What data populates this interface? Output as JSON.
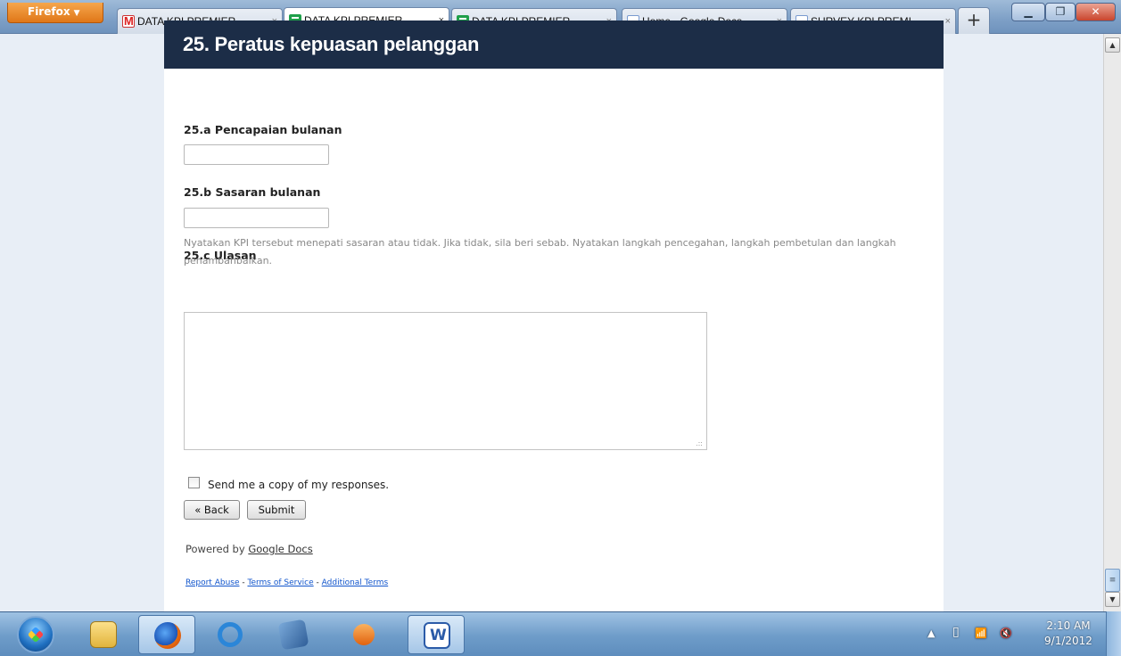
{
  "browser": {
    "menu_label": "Firefox",
    "tabs": [
      {
        "label": "DATA KPI PREMIER...",
        "icon": "gmail-icon",
        "active": false
      },
      {
        "label": "DATA KPI PREMIER...",
        "icon": "spreadsheet-icon",
        "active": true
      },
      {
        "label": "DATA KPI PREMIER...",
        "icon": "spreadsheet-icon",
        "active": false
      },
      {
        "label": "Home - Google Docs",
        "icon": "docs-icon",
        "active": false
      },
      {
        "label": "SURVEY KPI PREMI...",
        "icon": "docs-icon",
        "active": false
      }
    ],
    "close_glyph": "×",
    "new_tab_glyph": "+"
  },
  "form": {
    "section_title": "25. Peratus kepuasan pelanggan",
    "questions": [
      {
        "label": "25.a Pencapaian bulanan",
        "value": ""
      },
      {
        "label": "25.b Sasaran bulanan",
        "value": ""
      },
      {
        "label": "25.c Ulasan",
        "help": "Nyatakan KPI tersebut menepati sasaran atau tidak. Jika tidak, sila beri sebab. Nyatakan langkah pencegahan, langkah pembetulan dan langkah penambahbaikan.",
        "value": ""
      }
    ],
    "copy_label": "Send me a copy of my responses.",
    "copy_checked": false,
    "back_label": "« Back",
    "submit_label": "Submit",
    "powered_by_prefix": "Powered by ",
    "powered_by_link": "Google Docs",
    "footer_links": [
      "Report Abuse",
      "Terms of Service",
      "Additional Terms"
    ],
    "footer_separator": " - "
  },
  "taskbar": {
    "apps": [
      "windows-explorer",
      "firefox",
      "internet-explorer",
      "tools",
      "media-player",
      "microsoft-word"
    ],
    "clock_time": "2:10 AM",
    "clock_date": "9/1/2012"
  },
  "colors": {
    "header_bg": "#1c2d47",
    "link": "#1155cc"
  }
}
